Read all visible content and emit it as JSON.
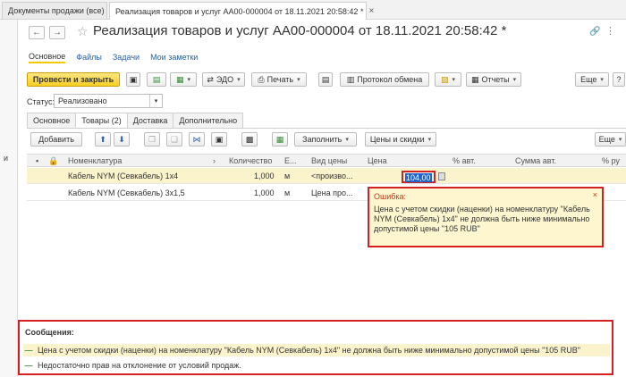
{
  "window_tabs": [
    {
      "label": "Документы продажи (все)"
    },
    {
      "label": "Реализация товаров и услуг АА00-000004 от 18.11.2021 20:58:42 *"
    }
  ],
  "left_letter": "и",
  "doc_title": "Реализация товаров и услуг АА00-000004 от 18.11.2021 20:58:42 *",
  "subtabs": [
    "Основное",
    "Файлы",
    "Задачи",
    "Мои заметки"
  ],
  "toolbar": {
    "post_close": "Провести и закрыть",
    "edo": "ЭДО",
    "print": "Печать",
    "protocol": "Протокол обмена",
    "reports": "Отчеты",
    "more": "Еще",
    "help": "?"
  },
  "status": {
    "label": "Статус:",
    "value": "Реализовано"
  },
  "doc_tabs": [
    "Основное",
    "Товары (2)",
    "Доставка",
    "Дополнительно"
  ],
  "grid_toolbar": {
    "add": "Добавить",
    "fill": "Заполнить",
    "prices": "Цены и скидки",
    "more": "Еще"
  },
  "columns": {
    "nomenclature": "Номенклатура",
    "quantity": "Количество",
    "unit": "Е...",
    "price_type": "Вид цены",
    "price": "Цена",
    "vat_pct": "% авт.",
    "sum_auto": "Сумма авт.",
    "pct_manual": "% ру"
  },
  "rows": [
    {
      "name": "Кабель NYM (Севкабель) 1х4",
      "qty": "1,000",
      "unit": "м",
      "price_type": "<произво...",
      "price": "104,00"
    },
    {
      "name": "Кабель NYM (Севкабель) 3х1,5",
      "qty": "1,000",
      "unit": "м",
      "price_type": "Цена про...",
      "price": ""
    }
  ],
  "error": {
    "title": "Ошибка:",
    "close": "×",
    "text": "Цена с учетом скидки (наценки) на номенклатуру \"Кабель NYM (Севкабель) 1х4\" не должна быть ниже минимально допустимой цены \"105 RUB\""
  },
  "messages": {
    "title": "Сообщения:",
    "items": [
      "Цена с учетом скидки (наценки) на номенклатуру \"Кабель NYM (Севкабель) 1х4\" не должна быть ниже минимально допустимой цены \"105 RUB\"",
      "Недостаточно прав на отклонение от условий продаж."
    ]
  },
  "colors": {
    "accent_yellow": "#f7cf23",
    "error_red": "#d42020",
    "link_blue": "#2a62a3",
    "selection_bg": "#fbf3cc"
  }
}
